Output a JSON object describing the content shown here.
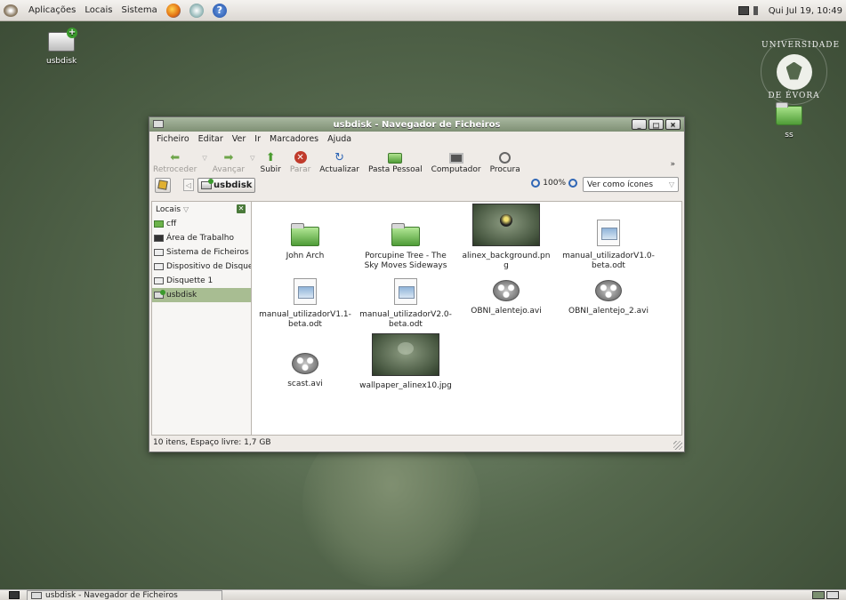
{
  "top_panel": {
    "menus": [
      "Aplicações",
      "Locais",
      "Sistema"
    ],
    "launchers": [
      "firefox-icon",
      "mail-icon",
      "help-icon"
    ],
    "clock": "Qui Jul 19, 10:49"
  },
  "desktop": {
    "icons": [
      {
        "label": "usbdisk"
      },
      {
        "label": "ss"
      }
    ],
    "logo": {
      "top": "UNIVERSIDADE",
      "bottom": "DE ÉVORA"
    }
  },
  "window": {
    "title": "usbdisk - Navegador de Ficheiros",
    "menu": [
      "Ficheiro",
      "Editar",
      "Ver",
      "Ir",
      "Marcadores",
      "Ajuda"
    ],
    "toolbar": {
      "back": "Retroceder",
      "forward": "Avançar",
      "up": "Subir",
      "stop": "Parar",
      "reload": "Actualizar",
      "home": "Pasta Pessoal",
      "computer": "Computador",
      "search": "Procura"
    },
    "location": {
      "path": "usbdisk",
      "zoom": "100%",
      "view_as": "Ver como ícones"
    },
    "sidebar": {
      "title": "Locais",
      "items": [
        {
          "label": "cff"
        },
        {
          "label": "Área de Trabalho"
        },
        {
          "label": "Sistema de Ficheiros"
        },
        {
          "label": "Dispositivo de Disquete"
        },
        {
          "label": "Disquette 1"
        },
        {
          "label": "usbdisk"
        }
      ]
    },
    "files": [
      {
        "name": "John Arch",
        "type": "folder"
      },
      {
        "name": "Porcupine Tree - The Sky Moves Sideways",
        "type": "folder"
      },
      {
        "name": "alinex_background.png",
        "type": "image"
      },
      {
        "name": "manual_utilizadorV1.0-beta.odt",
        "type": "document"
      },
      {
        "name": "manual_utilizadorV1.1-beta.odt",
        "type": "document"
      },
      {
        "name": "manual_utilizadorV2.0-beta.odt",
        "type": "document"
      },
      {
        "name": "OBNI_alentejo.avi",
        "type": "video"
      },
      {
        "name": "OBNI_alentejo_2.avi",
        "type": "video"
      },
      {
        "name": "scast.avi",
        "type": "video"
      },
      {
        "name": "wallpaper_alinex10.jpg",
        "type": "image"
      }
    ],
    "status": "10 itens, Espaço livre: 1,7 GB"
  },
  "bottom_panel": {
    "task": "usbdisk - Navegador de Ficheiros"
  }
}
